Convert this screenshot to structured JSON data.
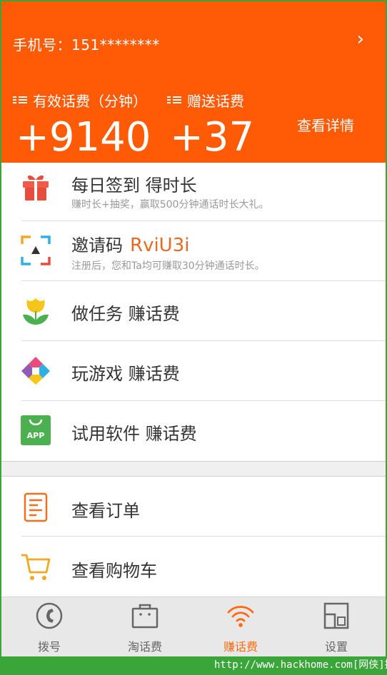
{
  "header": {
    "phone_label": "手机号：151********",
    "label_valid": "有效话费（分钟）",
    "label_gift": "赠送话费",
    "valid_minutes": "+9140",
    "gift_minutes": "+37",
    "details_link": "查看详情",
    "chevron": "›",
    "background_color": "#ff5a06"
  },
  "list": {
    "checkin_title": "每日签到 得时长",
    "checkin_sub": "赚时长+抽奖，赢取500分钟通话时长大礼。",
    "invite_title": "邀请码",
    "invite_code": "RviU3i",
    "invite_sub": "注册后，您和Ta均可赚取30分钟通话时长。",
    "tasks_title": "做任务 赚话费",
    "games_title": "玩游戏 赚话费",
    "apps_title": "试用软件 赚话费",
    "app_badge": "APP",
    "orders_title": "查看订单",
    "cart_title": "查看购物车"
  },
  "nav": {
    "dial": "拨号",
    "shop": "淘话费",
    "earn": "赚话费",
    "settings": "设置",
    "active": "earn",
    "active_color": "#ff6a10"
  },
  "watermark": "http://www.hackhome.com[网侠]提供"
}
